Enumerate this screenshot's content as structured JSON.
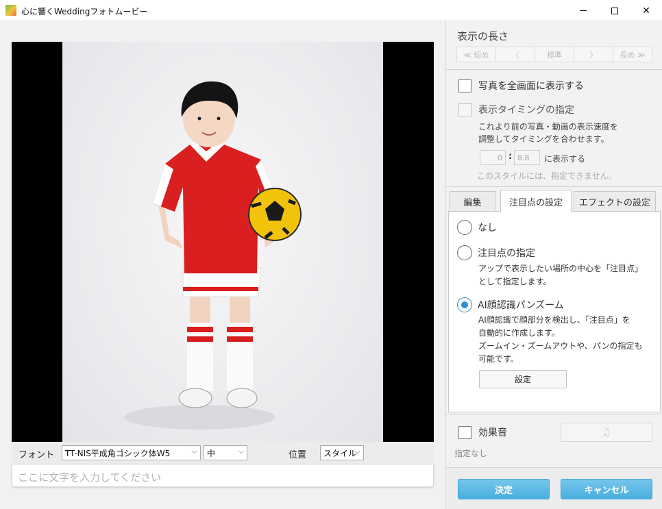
{
  "window": {
    "title": "心に響くWeddingフォトムービー",
    "min_glyph": "",
    "close_glyph": "✕"
  },
  "editor": {
    "toolbar": {
      "font_label": "フォント",
      "font_value": "TT-NIS平成角ゴシック体W5",
      "size_value": "中",
      "position_label": "位置",
      "position_value": "スタイル"
    },
    "text_input": {
      "placeholder": "ここに文字を入力してください"
    }
  },
  "duration": {
    "heading": "表示の長さ",
    "segments": [
      "≪ 短め",
      "〈",
      "標準",
      "〉",
      "長め ≫"
    ]
  },
  "options": {
    "fullscreen_label": "写真を全画面に表示する",
    "timing_label": "表示タイミングの指定",
    "timing_desc_1": "これより前の写真・動画の表示速度を",
    "timing_desc_2": "調整してタイミングを合わせます。",
    "timing_min": "0",
    "timing_sec": "8.8",
    "timing_suffix": "に表示する",
    "style_notice": "このスタイルには、指定できません。"
  },
  "tabs": [
    {
      "label": "編集"
    },
    {
      "label": "注目点の設定",
      "active": true
    },
    {
      "label": "エフェクトの設定"
    }
  ],
  "focus_panel": {
    "none_label": "なし",
    "manual_label": "注目点の指定",
    "manual_desc_1": "アップで表示したい場所の中心を「注目点」",
    "manual_desc_2": "として指定します。",
    "ai_label": "AI顔認識パンズーム",
    "ai_desc_1": "AI顔認識で顔部分を検出し、「注目点」を",
    "ai_desc_2": "自動的に作成します。",
    "ai_desc_3": "ズームイン・ズームアウトや、パンの指定も",
    "ai_desc_4": "可能です。",
    "setting_button": "設定",
    "selected": "ai"
  },
  "sound": {
    "label": "効果音",
    "music_icon": "music-note-icon",
    "status": "指定なし"
  },
  "actions": {
    "ok": "決定",
    "cancel": "キャンセル"
  },
  "colors": {
    "accent": "#2b8fd6",
    "button_blue": "#49aede"
  }
}
